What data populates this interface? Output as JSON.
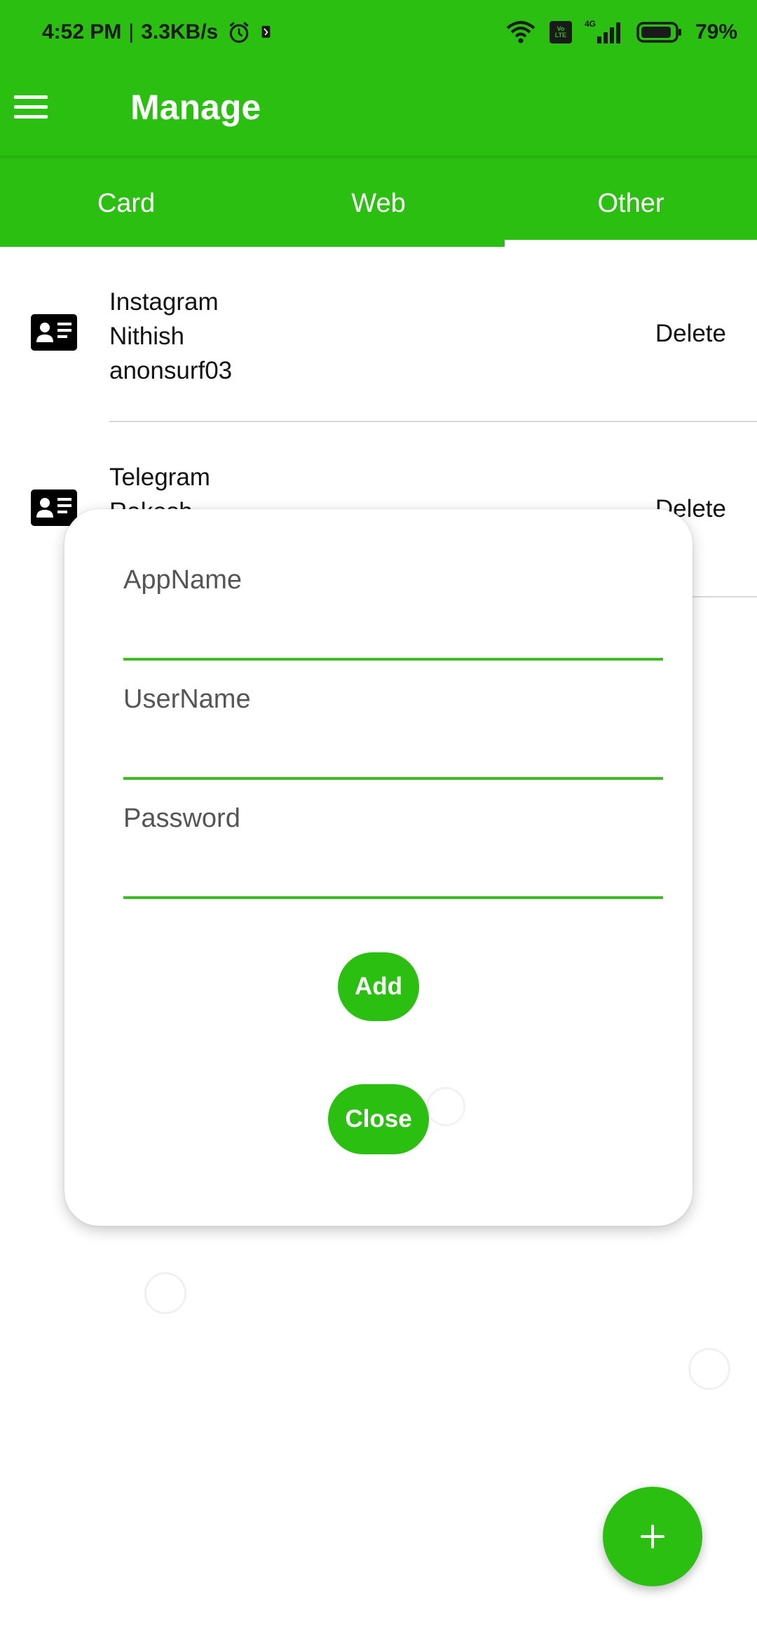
{
  "status_bar": {
    "time": "4:52 PM",
    "separator": "|",
    "net_speed": "3.3KB/s",
    "battery_percent": "79%",
    "icons": [
      "alarm-icon",
      "notification-icon",
      "wifi-icon",
      "volte-icon",
      "signal-4g-icon",
      "battery-icon"
    ],
    "volte_text": "Vo LTE",
    "network_text": "4G"
  },
  "app_bar": {
    "title": "Manage",
    "menu_icon": "hamburger-menu-icon"
  },
  "tabs": [
    {
      "label": "Card",
      "active": false
    },
    {
      "label": "Web",
      "active": false
    },
    {
      "label": "Other",
      "active": true
    }
  ],
  "entries": [
    {
      "app": "Instagram",
      "user": "Nithish",
      "password": "anonsurf03",
      "delete_label": "Delete",
      "icon": "id-card-icon"
    },
    {
      "app": "Telegram",
      "user": "Rakesh",
      "password": "",
      "delete_label": "Delete",
      "icon": "id-card-icon"
    }
  ],
  "dialog": {
    "fields": [
      {
        "label": "AppName",
        "value": ""
      },
      {
        "label": "UserName",
        "value": ""
      },
      {
        "label": "Password",
        "value": ""
      }
    ],
    "add_label": "Add",
    "close_label": "Close"
  },
  "fab": {
    "icon": "plus-icon"
  },
  "colors": {
    "primary": "#2bbf12",
    "underline": "#3dbd22",
    "text": "#111111",
    "label": "#555555"
  }
}
